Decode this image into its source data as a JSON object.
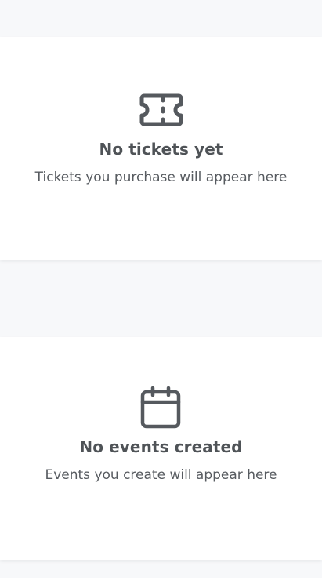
{
  "tickets_section": {
    "icon": "ticket-icon",
    "title": "No tickets yet",
    "subtitle": "Tickets you purchase will appear here"
  },
  "events_section": {
    "icon": "calendar-icon",
    "title": "No events created",
    "subtitle": "Events you create will appear here"
  },
  "colors": {
    "page_background": "#f7f8fa",
    "card_background": "#ffffff",
    "icon_stroke": "#55595e",
    "text": "#4f5357"
  }
}
